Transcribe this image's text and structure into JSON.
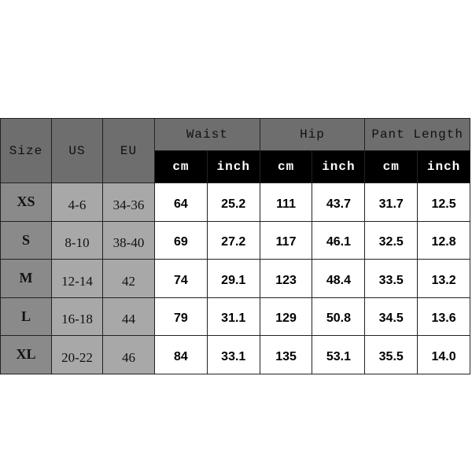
{
  "headers": {
    "size": "Size",
    "us": "US",
    "eu": "EU",
    "waist": "Waist",
    "hip": "Hip",
    "pant_length": "Pant Length",
    "cm": "cm",
    "inch": "inch"
  },
  "rows": [
    {
      "size": "XS",
      "us": "4-6",
      "eu": "34-36",
      "waist_cm": "64",
      "waist_in": "25.2",
      "hip_cm": "111",
      "hip_in": "43.7",
      "len_cm": "31.7",
      "len_in": "12.5"
    },
    {
      "size": "S",
      "us": "8-10",
      "eu": "38-40",
      "waist_cm": "69",
      "waist_in": "27.2",
      "hip_cm": "117",
      "hip_in": "46.1",
      "len_cm": "32.5",
      "len_in": "12.8"
    },
    {
      "size": "M",
      "us": "12-14",
      "eu": "42",
      "waist_cm": "74",
      "waist_in": "29.1",
      "hip_cm": "123",
      "hip_in": "48.4",
      "len_cm": "33.5",
      "len_in": "13.2"
    },
    {
      "size": "L",
      "us": "16-18",
      "eu": "44",
      "waist_cm": "79",
      "waist_in": "31.1",
      "hip_cm": "129",
      "hip_in": "50.8",
      "len_cm": "34.5",
      "len_in": "13.6"
    },
    {
      "size": "XL",
      "us": "20-22",
      "eu": "46",
      "waist_cm": "84",
      "waist_in": "33.1",
      "hip_cm": "135",
      "hip_in": "53.1",
      "len_cm": "35.5",
      "len_in": "14.0"
    }
  ]
}
